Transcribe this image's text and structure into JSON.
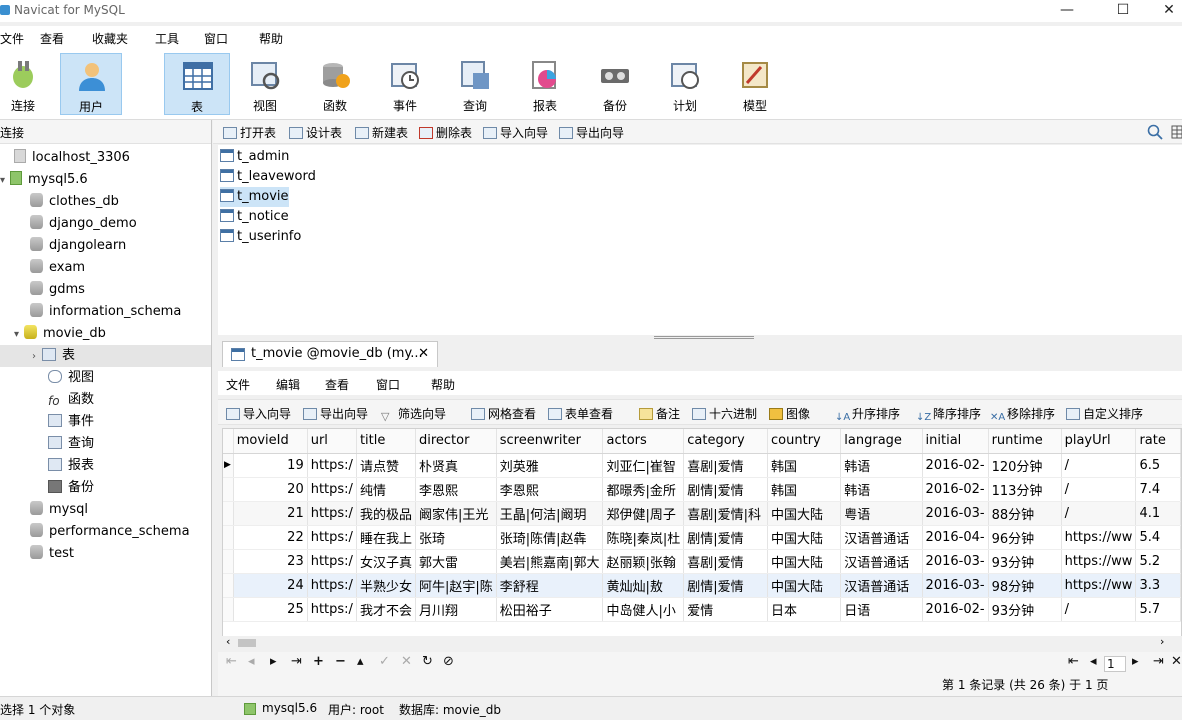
{
  "window": {
    "title": "Navicat for MySQL",
    "minimize": "—",
    "maximize": "☐",
    "close": "✕"
  },
  "menubar": [
    "文件",
    "查看",
    "收藏夹",
    "工具",
    "窗口",
    "帮助"
  ],
  "ribbon": [
    {
      "label": "连接",
      "icon": "connection-icon"
    },
    {
      "label": "用户",
      "icon": "user-icon"
    },
    {
      "label": "表",
      "icon": "table-icon"
    },
    {
      "label": "视图",
      "icon": "view-icon"
    },
    {
      "label": "函数",
      "icon": "function-icon"
    },
    {
      "label": "事件",
      "icon": "event-icon"
    },
    {
      "label": "查询",
      "icon": "query-icon"
    },
    {
      "label": "报表",
      "icon": "report-icon"
    },
    {
      "label": "备份",
      "icon": "backup-icon"
    },
    {
      "label": "计划",
      "icon": "schedule-icon"
    },
    {
      "label": "模型",
      "icon": "model-icon"
    }
  ],
  "left_panel": {
    "header": "连接",
    "items": [
      "localhost_3306",
      "mysql5.6",
      "clothes_db",
      "django_demo",
      "djangolearn",
      "exam",
      "gdms",
      "information_schema",
      "movie_db",
      "表",
      "视图",
      "函数",
      "事件",
      "查询",
      "报表",
      "备份",
      "mysql",
      "performance_schema",
      "test"
    ]
  },
  "object_toolbar": [
    "打开表",
    "设计表",
    "新建表",
    "删除表",
    "导入向导",
    "导出向导"
  ],
  "tables": [
    "t_admin",
    "t_leaveword",
    "t_movie",
    "t_notice",
    "t_userinfo"
  ],
  "tab": {
    "label": "t_movie @movie_db (my...",
    "close": "✕"
  },
  "inner_menubar": [
    "文件",
    "编辑",
    "查看",
    "窗口",
    "帮助"
  ],
  "inner_toolbar": [
    "导入向导",
    "导出向导",
    "筛选向导",
    "网格查看",
    "表单查看",
    "备注",
    "十六进制",
    "图像",
    "升序排序",
    "降序排序",
    "移除排序",
    "自定义排序"
  ],
  "grid": {
    "columns": [
      "movieId",
      "url",
      "title",
      "director",
      "screenwriter",
      "actors",
      "category",
      "country",
      "langrage",
      "initial",
      "runtime",
      "playUrl",
      "rate"
    ],
    "rows": [
      [
        "19",
        "https:/",
        "请点赞 ",
        "朴贤真",
        "刘英雅",
        "刘亚仁|崔智",
        "喜剧|爱情",
        "韩国",
        "韩语",
        "2016-02-",
        "120分钟",
        "/",
        "6.5"
      ],
      [
        "20",
        "https:/",
        "纯情 ",
        "李恩熙",
        "李恩熙",
        "都暻秀|金所",
        "剧情|爱情",
        "韩国",
        "韩语",
        "2016-02-",
        "113分钟",
        "/",
        "7.4"
      ],
      [
        "21",
        "https:/",
        "我的极品",
        "阚家伟|王光",
        "王晶|何洁|阚玥",
        "郑伊健|周子",
        "喜剧|爱情|科",
        "中国大陆",
        "粤语",
        "2016-03-",
        "88分钟",
        "/",
        "4.1"
      ],
      [
        "22",
        "https:/",
        "睡在我上",
        "张琦",
        "张琦|陈倩|赵犇",
        "陈晓|秦岚|杜",
        "剧情|爱情",
        "中国大陆",
        "汉语普通话",
        "2016-04-",
        "96分钟",
        "https://ww",
        "5.4"
      ],
      [
        "23",
        "https:/",
        "女汉子真",
        "郭大雷",
        "美岩|熊嘉南|郭大",
        "赵丽颖|张翰",
        "喜剧|爱情",
        "中国大陆",
        "汉语普通话",
        "2016-03-",
        "93分钟",
        "https://ww",
        "5.2"
      ],
      [
        "24",
        "https:/",
        "半熟少女",
        "阿牛|赵宇|陈",
        "李舒程",
        "黄灿灿|敖",
        "剧情|爱情",
        "中国大陆",
        "汉语普通话",
        "2016-03-",
        "98分钟",
        "https://ww",
        "3.3"
      ],
      [
        "25",
        "https:/",
        "我才不会",
        "月川翔",
        "松田裕子",
        "中岛健人|小",
        "爱情",
        "日本",
        "日语",
        "2016-02-",
        "93分钟",
        "/",
        "5.7"
      ]
    ]
  },
  "pager": {
    "page": "1",
    "record_info": "第 1 条记录 (共 26 条) 于 1 页"
  },
  "status": {
    "left": "选择 1 个对象",
    "connection": "mysql5.6",
    "user": "用户: root",
    "database": "数据库: movie_db"
  }
}
